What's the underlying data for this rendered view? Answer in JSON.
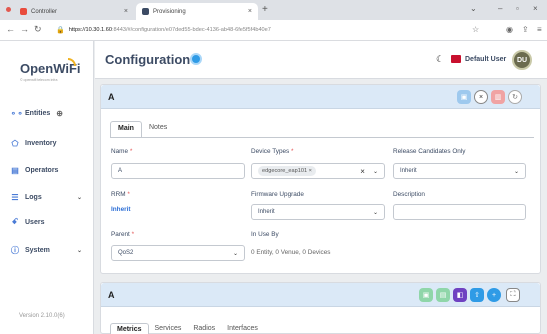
{
  "browser": {
    "tabs": [
      {
        "title": "Controller",
        "color": "#e94b3c"
      },
      {
        "title": "Provisioning",
        "color": "#3c4b64"
      }
    ],
    "url_host": "https://10.30.1.60",
    "url_path": ":8443/#/configuration/e07ded55-bdec-4136-ab48-6fe5f5f4b40e7"
  },
  "sidebar": {
    "logo": "OpenWiFi",
    "logo_sub": "© openwifi telecom infra",
    "items": [
      {
        "label": "Entities",
        "icon": "network-icon"
      },
      {
        "label": "Inventory",
        "icon": "tag-icon"
      },
      {
        "label": "Operators",
        "icon": "calendar-icon"
      },
      {
        "label": "Logs",
        "icon": "list-icon"
      },
      {
        "label": "Users",
        "icon": "users-icon"
      },
      {
        "label": "System",
        "icon": "info-icon"
      }
    ],
    "version": "Version 2.10.0(6)"
  },
  "topbar": {
    "title": "Configuration",
    "user": "Default User",
    "initials": "DU"
  },
  "config_card": {
    "title": "A",
    "tabs": [
      "Main",
      "Notes"
    ],
    "name_label": "Name",
    "name_value": "A",
    "device_types_label": "Device Types",
    "device_type_chip": "edgecore_eap101 ×",
    "release_label": "Release Candidates Only",
    "release_value": "Inherit",
    "rrm_label": "RRM",
    "rrm_value": "Inherit",
    "firmware_label": "Firmware Upgrade",
    "firmware_value": "Inherit",
    "description_label": "Description",
    "description_value": "",
    "parent_label": "Parent",
    "parent_value": "QoS2",
    "in_use_label": "In Use By",
    "in_use_value": "0 Entity, 0 Venue, 0 Devices"
  },
  "sections_card": {
    "title": "A",
    "tabs": [
      "Metrics",
      "Services",
      "Radios",
      "Interfaces"
    ]
  },
  "colors": {
    "header_bg": "#dbe9f7",
    "accent": "#2f9be6",
    "danger": "#e55353",
    "success": "#2eb85c",
    "purple": "#6f42c1"
  }
}
